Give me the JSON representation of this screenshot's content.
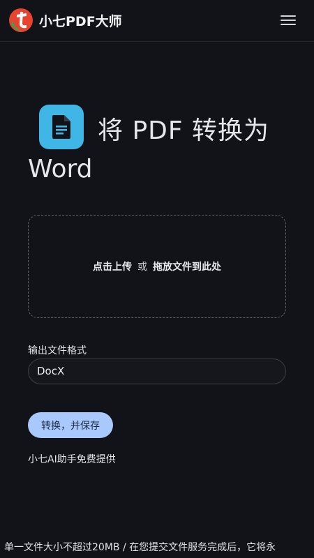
{
  "header": {
    "brand": "小七PDF大师",
    "logo_icon": "logo-icon",
    "menu_icon": "hamburger-menu-icon"
  },
  "title": {
    "icon": "file-document-icon",
    "line1": "将 PDF 转换为",
    "line2": "Word"
  },
  "dropzone": {
    "upload_text": "点击上传",
    "or_text": "或",
    "drag_text": "拖放文件到此处"
  },
  "format": {
    "label": "输出文件格式",
    "value": "DocX"
  },
  "convert_button": {
    "label": "转换，并保存"
  },
  "powered_by": "小七AI助手免费提供",
  "footer": {
    "notice": "单一文件大小不超过20MB / 在您提交文件服务完成后，它将永"
  },
  "colors": {
    "background": "#111318",
    "accent_button": "#a9c8fb",
    "icon_tile": "#3fb6e6",
    "logo_red": "#e8432e",
    "logo_green": "#3aa24a"
  }
}
